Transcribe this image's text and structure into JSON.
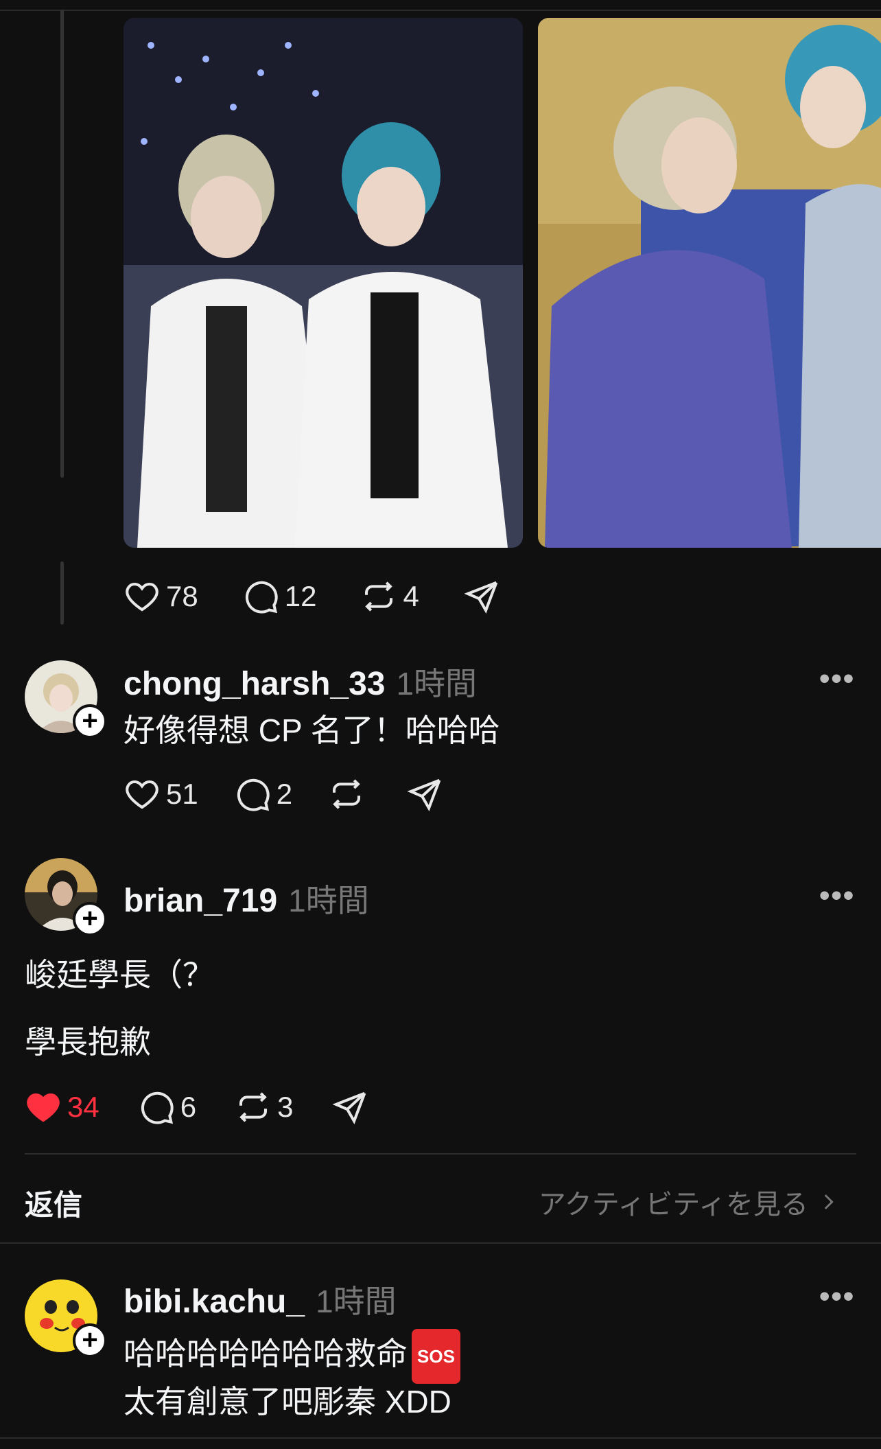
{
  "post": {
    "stats": {
      "likes": "78",
      "replies": "12",
      "reposts": "4"
    }
  },
  "comments": [
    {
      "username": "chong_harsh_33",
      "time": "1時間",
      "lines": [
        "好像得想 CP 名了！哈哈哈"
      ],
      "stats": {
        "likes": "51",
        "replies": "2",
        "reposts": ""
      }
    },
    {
      "username": "brian_719",
      "time": "1時間",
      "lines": [
        "峻廷學長（？",
        "學長抱歉"
      ],
      "stats": {
        "likes": "34",
        "replies": "6",
        "reposts": "3"
      },
      "liked": true
    }
  ],
  "replies_section": {
    "label": "返信",
    "activity_link": "アクティビティを見る"
  },
  "reply": {
    "username": "bibi.kachu_",
    "time": "1時間",
    "line1": "哈哈哈哈哈哈哈救命",
    "sos_badge": "SOS",
    "line2": "太有創意了吧彫秦 XDD"
  },
  "colors": {
    "background": "#101010",
    "like_active": "#ff3040",
    "muted": "#777777"
  },
  "icons": [
    "heart-icon",
    "comment-icon",
    "repost-icon",
    "share-icon",
    "more-icon",
    "follow-plus-icon",
    "chevron-right-icon"
  ]
}
